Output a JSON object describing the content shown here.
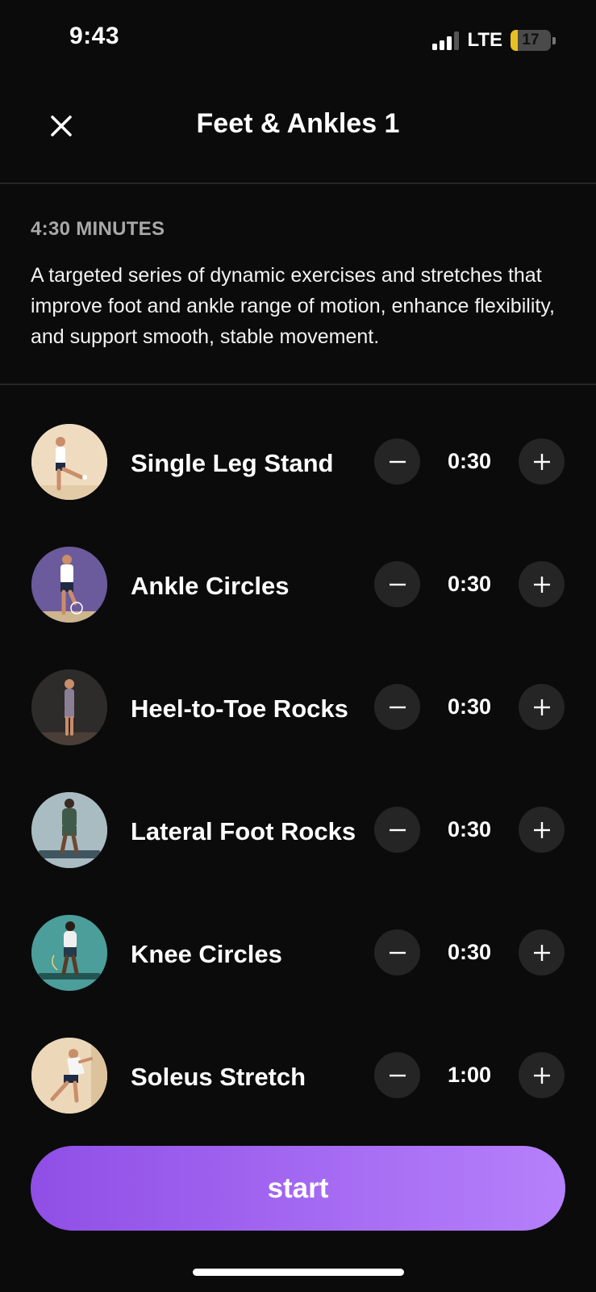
{
  "status_bar": {
    "time": "9:43",
    "network": "LTE",
    "battery": "17",
    "battery_level": 0.17
  },
  "header": {
    "title": "Feet & Ankles 1",
    "close_icon": "close-icon"
  },
  "info": {
    "duration": "4:30 MINUTES",
    "description": "A targeted series of dynamic exercises and stretches that improve foot and ankle range of motion, enhance flexibility, and support smooth, stable movement."
  },
  "exercises": [
    {
      "name": "Single Leg Stand",
      "time": "0:30",
      "thumb_bg": "#efdcc0"
    },
    {
      "name": "Ankle Circles",
      "time": "0:30",
      "thumb_bg": "#6b5a9c"
    },
    {
      "name": "Heel-to-Toe Rocks",
      "time": "0:30",
      "thumb_bg": "#2e2b2b"
    },
    {
      "name": "Lateral Foot Rocks",
      "time": "0:30",
      "thumb_bg": "#a9bcc2"
    },
    {
      "name": "Knee Circles",
      "time": "0:30",
      "thumb_bg": "#4b9e9a"
    },
    {
      "name": "Soleus Stretch",
      "time": "1:00",
      "thumb_bg": "#ecd8b8"
    }
  ],
  "start_button": {
    "label": "start"
  },
  "colors": {
    "background": "#0b0b0b",
    "accent": "#a56af2",
    "control_bg": "#252525",
    "muted_text": "#a8a8a8"
  }
}
